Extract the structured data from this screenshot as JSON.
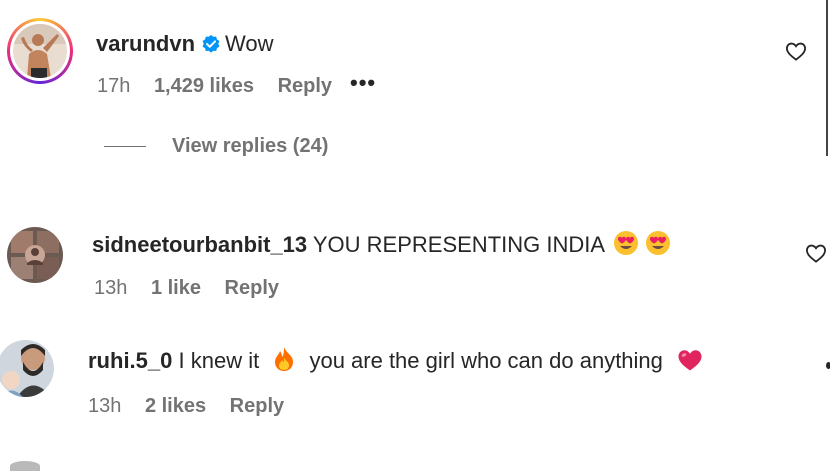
{
  "comments": [
    {
      "username": "varundvn",
      "verified": true,
      "text": "Wow",
      "time": "17h",
      "likes": "1,429 likes",
      "reply": "Reply",
      "more": "•••",
      "avatar_icon": "shirtless-man-avatar",
      "has_story_ring": true
    },
    {
      "username": "sidneetourbanbit_13",
      "text": "YOU REPRESENTING INDIA",
      "emojis": [
        "heart-eyes-emoji",
        "heart-eyes-emoji"
      ],
      "time": "13h",
      "likes": "1 like",
      "reply": "Reply",
      "avatar_icon": "fan-collage-avatar"
    },
    {
      "username": "ruhi.5_0",
      "text_before": "I knew it",
      "emoji_mid": "fire-emoji",
      "text_after": "you are the girl who can do anything",
      "emoji_end": "red-heart-emoji",
      "time": "13h",
      "likes": "2 likes",
      "reply": "Reply",
      "avatar_icon": "bearded-man-with-baby-avatar"
    }
  ],
  "view_replies": "View replies (24)",
  "colors": {
    "primary_text": "#262626",
    "secondary_text": "#737373",
    "verified_blue": "#0095f6",
    "heart_red": "#e0245e"
  }
}
